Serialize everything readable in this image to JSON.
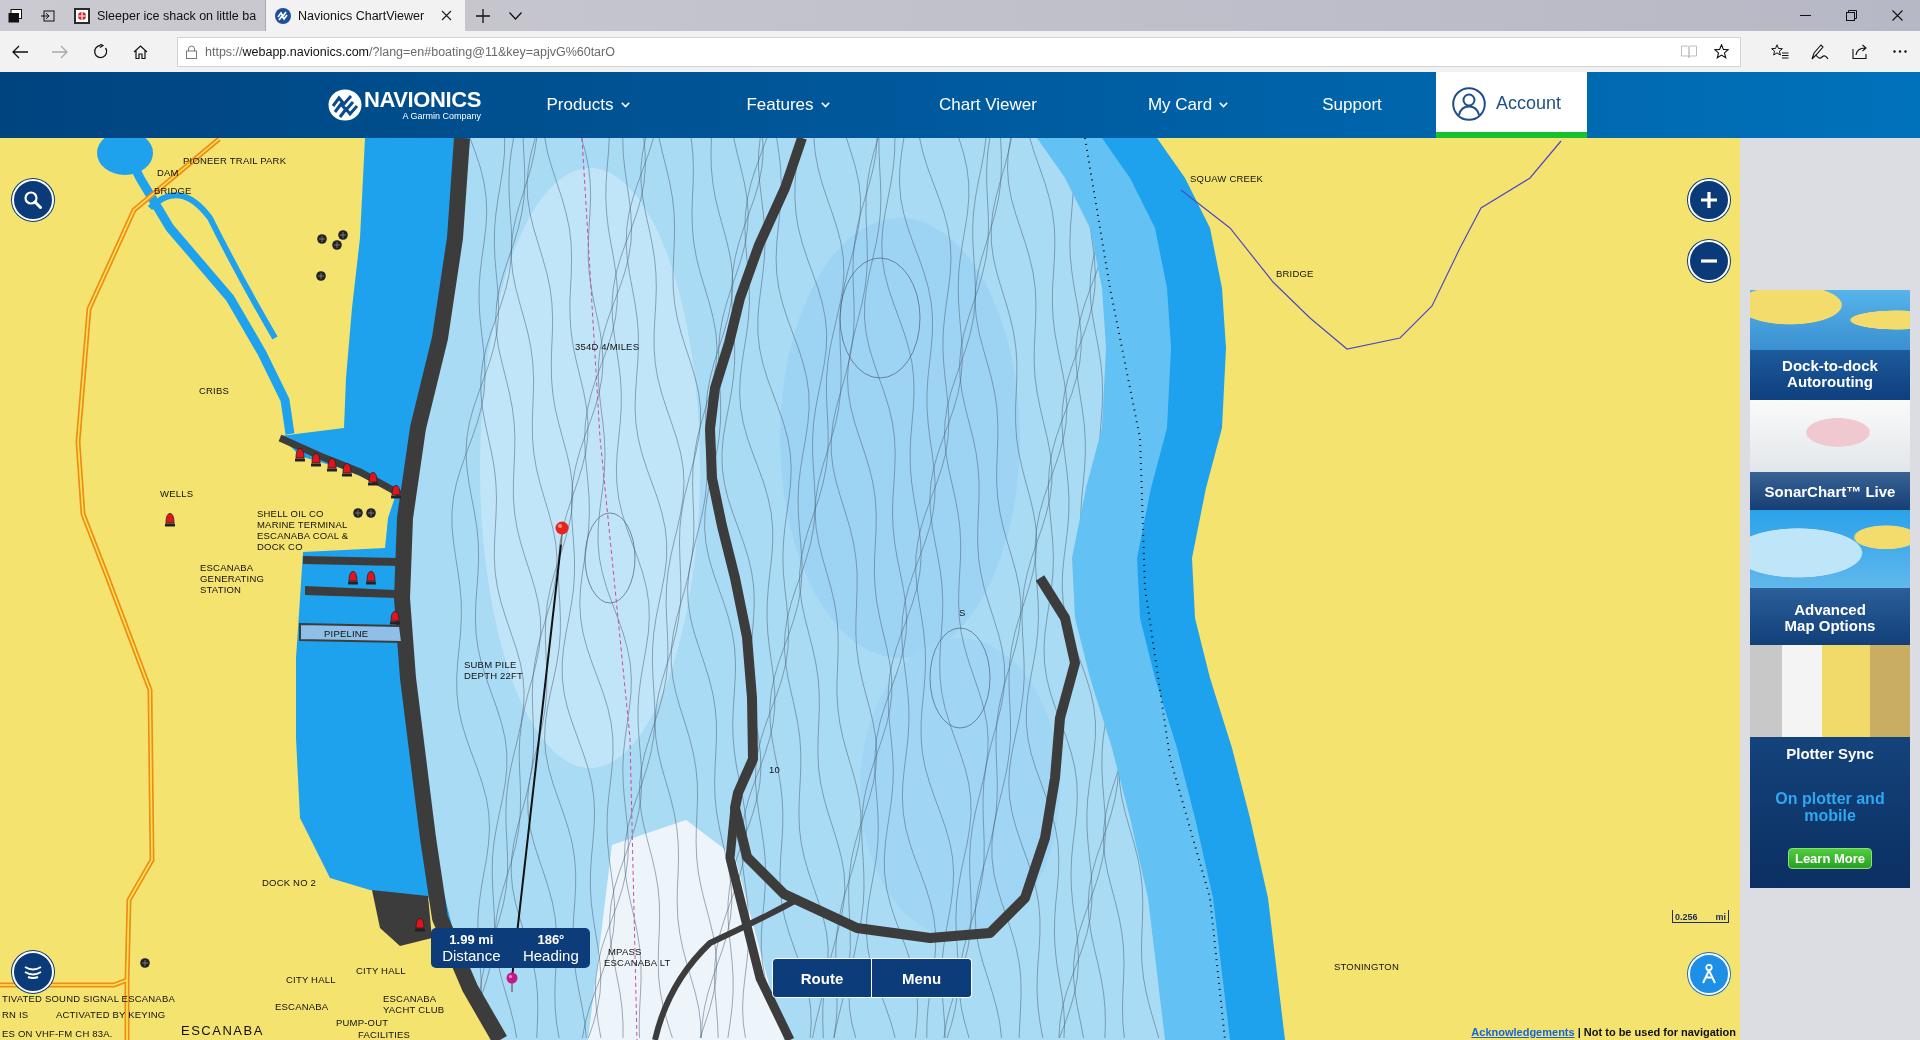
{
  "browser": {
    "tabs": [
      {
        "title": "Sleeper ice shack on little ba",
        "selected": false
      },
      {
        "title": "Navionics ChartViewer",
        "selected": true
      }
    ],
    "address": {
      "scheme": "https://",
      "host": "webapp.navionics.com",
      "path": "/?lang=en#boating@11&key=apjvG%60tarO"
    }
  },
  "nav": {
    "brand": "NAVIONICS",
    "tagline": "A Garmin Company",
    "items": [
      {
        "label": "Products",
        "dropdown": true
      },
      {
        "label": "Features",
        "dropdown": true
      },
      {
        "label": "Chart Viewer",
        "dropdown": false
      },
      {
        "label": "My Card",
        "dropdown": true
      },
      {
        "label": "Support",
        "dropdown": false
      }
    ],
    "account": "Account"
  },
  "map": {
    "labels": [
      {
        "kind": "place",
        "lines": [
          "PIONEER TRAIL PARK"
        ]
      },
      {
        "kind": "place",
        "lines": [
          "DAM"
        ]
      },
      {
        "kind": "place",
        "lines": [
          "BRIDGE"
        ]
      },
      {
        "kind": "place",
        "lines": [
          "SQUAW CREEK"
        ]
      },
      {
        "kind": "place",
        "lines": [
          "BRIDGE"
        ]
      },
      {
        "kind": "place",
        "lines": [
          "354D 4/MILES"
        ]
      },
      {
        "kind": "place",
        "lines": [
          "CRIBS"
        ]
      },
      {
        "kind": "place",
        "lines": [
          "WELLS"
        ]
      },
      {
        "kind": "place",
        "lines": [
          "SHELL OIL CO",
          "MARINE TERMINAL",
          "ESCANABA COAL &",
          "DOCK CO"
        ]
      },
      {
        "kind": "place",
        "lines": [
          "ESCANABA",
          "GENERATING",
          "STATION"
        ]
      },
      {
        "kind": "place",
        "lines": [
          "PIPELINE"
        ]
      },
      {
        "kind": "place",
        "lines": [
          "SUBM PILE",
          "DEPTH 22FT"
        ]
      },
      {
        "kind": "place",
        "lines": [
          "S"
        ]
      },
      {
        "kind": "place",
        "lines": [
          "10"
        ]
      },
      {
        "kind": "place",
        "lines": [
          "DOCK NO 2"
        ]
      },
      {
        "kind": "place",
        "lines": [
          "MPASS"
        ]
      },
      {
        "kind": "place",
        "lines": [
          "ESCANABA LT"
        ]
      },
      {
        "kind": "place",
        "lines": [
          "STONINGTON"
        ]
      },
      {
        "kind": "place",
        "lines": [
          "CITY HALL"
        ]
      },
      {
        "kind": "place",
        "lines": [
          "CITY HALL"
        ]
      },
      {
        "kind": "place",
        "lines": [
          "TIVATED SOUND SIGNAL ESCANABA"
        ]
      },
      {
        "kind": "place",
        "lines": [
          "ESCANABA"
        ]
      },
      {
        "kind": "place",
        "lines": [
          "ESCANABA",
          "YACHT CLUB"
        ]
      },
      {
        "kind": "place",
        "lines": [
          "RN IS"
        ]
      },
      {
        "kind": "place",
        "lines": [
          "ACTIVATED BY KEYING"
        ]
      },
      {
        "kind": "place",
        "lines": [
          "PUMP-OUT"
        ]
      },
      {
        "kind": "place",
        "lines": [
          "ES ON VHF-FM CH 83A."
        ]
      },
      {
        "kind": "town",
        "lines": [
          "ESCANABA"
        ]
      },
      {
        "kind": "place",
        "lines": [
          "FACILITIES"
        ]
      }
    ],
    "measure": {
      "distance": "1.99 mi",
      "distance_label": "Distance",
      "heading": "186°",
      "heading_label": "Heading"
    },
    "buttons": [
      "Route",
      "Menu"
    ],
    "scale": {
      "value": "0.256",
      "unit": "mi"
    },
    "footer": {
      "link": "Acknowledgements",
      "text": "| Not to be used for navigation"
    }
  },
  "ad": {
    "panels": [
      {
        "kind": "autorouting",
        "caption": "Dock-to-dock Autorouting"
      },
      {
        "kind": "sonarchart",
        "caption": "SonarChart™ Live"
      },
      {
        "kind": "advanced",
        "caption": "Advanced Map Options"
      },
      {
        "kind": "plotter",
        "caption": "Plotter Sync",
        "subcaption": "On plotter and mobile",
        "button": "Learn More"
      }
    ]
  }
}
